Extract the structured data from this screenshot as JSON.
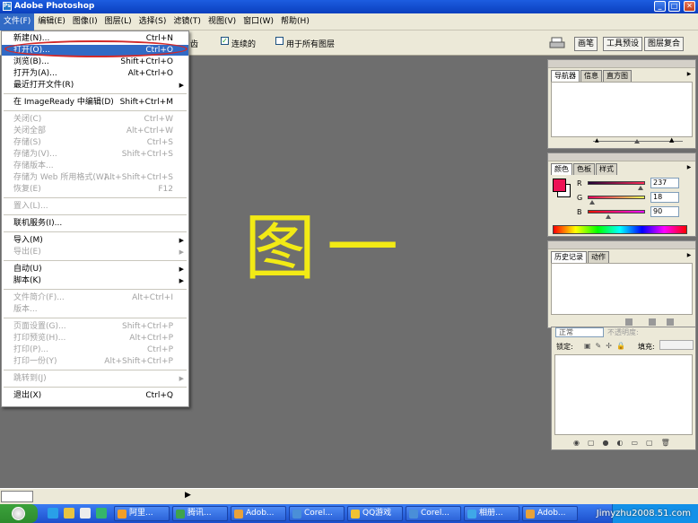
{
  "window": {
    "title": "Adobe Photoshop",
    "icon": "photoshop-icon",
    "controls": [
      "minimize-icon",
      "maximize-icon",
      "close-icon"
    ]
  },
  "menubar": [
    {
      "label": "文件(F)",
      "active": true
    },
    {
      "label": "编辑(E)"
    },
    {
      "label": "图像(I)"
    },
    {
      "label": "图层(L)"
    },
    {
      "label": "选择(S)"
    },
    {
      "label": "滤镜(T)"
    },
    {
      "label": "视图(V)"
    },
    {
      "label": "窗口(W)"
    },
    {
      "label": "帮助(H)"
    }
  ],
  "options": {
    "partial_label": "齿",
    "contiguous": {
      "label": "连续的",
      "checked": true
    },
    "all_layers": {
      "label": "用于所有图层",
      "checked": false
    },
    "palette_tabs": [
      "画笔",
      "工具预设",
      "图层复合"
    ]
  },
  "file_menu": {
    "items": [
      {
        "label": "新建(N)...",
        "shortcut": "Ctrl+N"
      },
      {
        "label": "打开(O)...",
        "shortcut": "Ctrl+O",
        "selected": true,
        "circled": true
      },
      {
        "label": "浏览(B)...",
        "shortcut": "Shift+Ctrl+O"
      },
      {
        "label": "打开为(A)...",
        "shortcut": "Alt+Ctrl+O"
      },
      {
        "label": "最近打开文件(R)",
        "submenu": true
      },
      {
        "label": "在 ImageReady 中编辑(D)",
        "shortcut": "Shift+Ctrl+M"
      },
      {
        "label": "关闭(C)",
        "shortcut": "Ctrl+W",
        "disabled": true
      },
      {
        "label": "关闭全部",
        "shortcut": "Alt+Ctrl+W",
        "disabled": true
      },
      {
        "label": "存储(S)",
        "shortcut": "Ctrl+S",
        "disabled": true
      },
      {
        "label": "存储为(V)...",
        "shortcut": "Shift+Ctrl+S",
        "disabled": true
      },
      {
        "label": "存储版本...",
        "disabled": true
      },
      {
        "label": "存储为 Web 所用格式(W)...",
        "shortcut": "Alt+Shift+Ctrl+S",
        "disabled": true
      },
      {
        "label": "恢复(E)",
        "shortcut": "F12",
        "disabled": true
      },
      {
        "label": "置入(L)...",
        "disabled": true
      },
      {
        "label": "联机服务(I)..."
      },
      {
        "label": "导入(M)",
        "submenu": true
      },
      {
        "label": "导出(E)",
        "submenu": true,
        "disabled": true
      },
      {
        "label": "自动(U)",
        "submenu": true
      },
      {
        "label": "脚本(K)",
        "submenu": true
      },
      {
        "label": "文件简介(F)...",
        "shortcut": "Alt+Ctrl+I",
        "disabled": true
      },
      {
        "label": "版本...",
        "disabled": true
      },
      {
        "label": "页面设置(G)...",
        "shortcut": "Shift+Ctrl+P",
        "disabled": true
      },
      {
        "label": "打印预览(H)...",
        "shortcut": "Alt+Ctrl+P",
        "disabled": true
      },
      {
        "label": "打印(P)...",
        "shortcut": "Ctrl+P",
        "disabled": true
      },
      {
        "label": "打印一份(Y)",
        "shortcut": "Alt+Shift+Ctrl+P",
        "disabled": true
      },
      {
        "label": "跳转到(J)",
        "submenu": true,
        "disabled": true
      },
      {
        "label": "退出(X)",
        "shortcut": "Ctrl+Q"
      }
    ]
  },
  "canvas": {
    "text": "图一",
    "text_color": "#f2ea15"
  },
  "navigator_panel": {
    "tabs": [
      "导航器",
      "信息",
      "直方图"
    ]
  },
  "color_panel": {
    "tabs": [
      "颜色",
      "色板",
      "样式"
    ],
    "foreground": "#ed1255",
    "r": {
      "label": "R",
      "value": "237"
    },
    "g": {
      "label": "G",
      "value": "18"
    },
    "b": {
      "label": "B",
      "value": "90"
    }
  },
  "history_panel": {
    "tabs": [
      "历史记录",
      "动作"
    ]
  },
  "layers_panel": {
    "blend_mode": "正常",
    "opacity_label": "不透明度:",
    "lock_label": "锁定:",
    "fill_label": "填充:"
  },
  "taskbar": {
    "items": [
      "阿里...",
      "腾讯...",
      "Adob...",
      "Corel...",
      "QQ游戏",
      "Corel...",
      "相册...",
      "Adob..."
    ]
  },
  "watermark": "Jimyzhu2008.51.com"
}
